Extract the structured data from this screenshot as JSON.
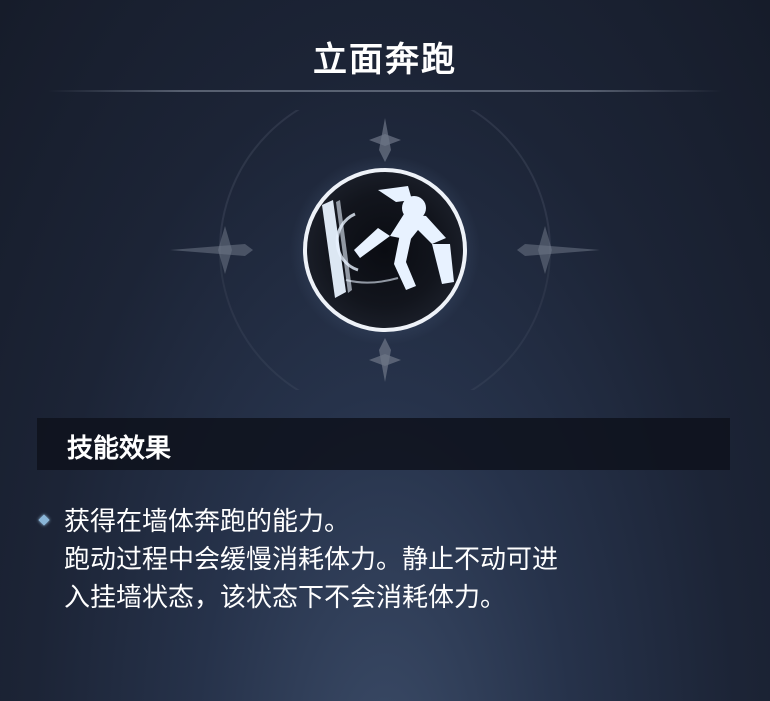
{
  "skill": {
    "title": "立面奔跑",
    "icon": "wall-run-icon"
  },
  "effect_section": {
    "header": "技能效果",
    "lines": [
      "获得在墙体奔跑的能力。",
      "跑动过程中会缓慢消耗体力。静止不动可进",
      "入挂墙状态，该状态下不会消耗体力。"
    ]
  },
  "colors": {
    "background": "#1c2436",
    "text": "#ffffff",
    "header_bar": "#0e121c",
    "bullet": "#8ab6d8"
  }
}
